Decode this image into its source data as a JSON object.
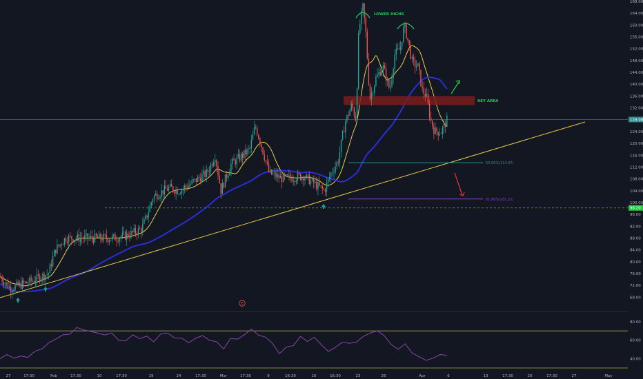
{
  "chart_data": [
    {
      "type": "candlestick",
      "panel": "price",
      "ylim": [
        66,
        168
      ],
      "y_ticks": [
        68,
        72,
        76,
        80,
        84,
        88,
        92,
        96,
        100,
        104,
        108,
        112,
        116,
        120,
        124,
        128,
        132,
        136,
        140,
        144,
        148,
        152,
        156,
        160,
        164,
        168
      ],
      "x_tick_labels": [
        "27",
        "17:30",
        "Feb",
        "17:30",
        "10",
        "17:30",
        "19",
        "24",
        "17:30",
        "Mar",
        "17:30",
        "9",
        "16:30",
        "16",
        "16:30",
        "23",
        "26",
        "Apr",
        "6",
        "13",
        "17:30",
        "20",
        "17:30",
        "27",
        "May"
      ],
      "price_key_points": [
        {
          "x": 0,
          "y": 75
        },
        {
          "x": 15,
          "y": 71
        },
        {
          "x": 40,
          "y": 73
        },
        {
          "x": 70,
          "y": 76
        },
        {
          "x": 80,
          "y": 84
        },
        {
          "x": 95,
          "y": 88
        },
        {
          "x": 120,
          "y": 88
        },
        {
          "x": 165,
          "y": 88
        },
        {
          "x": 185,
          "y": 89
        },
        {
          "x": 205,
          "y": 91
        },
        {
          "x": 212,
          "y": 95
        },
        {
          "x": 222,
          "y": 102
        },
        {
          "x": 245,
          "y": 105
        },
        {
          "x": 260,
          "y": 104
        },
        {
          "x": 280,
          "y": 107
        },
        {
          "x": 300,
          "y": 110
        },
        {
          "x": 312,
          "y": 116
        },
        {
          "x": 320,
          "y": 104
        },
        {
          "x": 335,
          "y": 113
        },
        {
          "x": 352,
          "y": 116
        },
        {
          "x": 362,
          "y": 118
        },
        {
          "x": 370,
          "y": 126
        },
        {
          "x": 378,
          "y": 120
        },
        {
          "x": 390,
          "y": 110
        },
        {
          "x": 410,
          "y": 108
        },
        {
          "x": 440,
          "y": 109
        },
        {
          "x": 458,
          "y": 106
        },
        {
          "x": 470,
          "y": 104
        },
        {
          "x": 480,
          "y": 110
        },
        {
          "x": 490,
          "y": 114
        },
        {
          "x": 500,
          "y": 127
        },
        {
          "x": 510,
          "y": 133
        },
        {
          "x": 516,
          "y": 128
        },
        {
          "x": 520,
          "y": 158
        },
        {
          "x": 526,
          "y": 166
        },
        {
          "x": 530,
          "y": 158
        },
        {
          "x": 536,
          "y": 135
        },
        {
          "x": 545,
          "y": 142
        },
        {
          "x": 555,
          "y": 146
        },
        {
          "x": 565,
          "y": 138
        },
        {
          "x": 572,
          "y": 150
        },
        {
          "x": 580,
          "y": 152
        },
        {
          "x": 586,
          "y": 160
        },
        {
          "x": 592,
          "y": 154
        },
        {
          "x": 598,
          "y": 147
        },
        {
          "x": 606,
          "y": 146
        },
        {
          "x": 612,
          "y": 138
        },
        {
          "x": 618,
          "y": 136
        },
        {
          "x": 624,
          "y": 128
        },
        {
          "x": 630,
          "y": 124
        },
        {
          "x": 640,
          "y": 124
        },
        {
          "x": 648,
          "y": 128
        }
      ],
      "current_price": 128.08,
      "current_price_label": "128.08",
      "support_price": 98.2,
      "support_label": "98.20",
      "key_area": {
        "low": 133,
        "high": 136,
        "label": "KEY AREA"
      },
      "annotation_lower_highs": "LOWER HIGHS",
      "fib_50": {
        "price": 113.47,
        "label": "50.00%(113.47)"
      },
      "fib_618": {
        "price": 101.21,
        "label": "61.80%(101.21)"
      },
      "ma_fast_color": "#e8d24a",
      "ma_slow_color": "#2a2ed8",
      "trendline_color": "#e6c84a",
      "up_color": "#26a69a",
      "down_color": "#ef5350",
      "arrow_up_color": "#27c93f",
      "arrow_down_color": "#e03b3b",
      "key_area_color": "#7a1c1c",
      "support_color": "#27c93f",
      "fib_50_color": "#2a8f8f",
      "fib_618_color": "#8b3fd6",
      "lower_highs_color": "#22c55e",
      "markers": [
        "E"
      ]
    },
    {
      "type": "line",
      "panel": "rsi",
      "series": [
        {
          "values": [
            38,
            42,
            39,
            45,
            43,
            48,
            52,
            55,
            60,
            65,
            68,
            72,
            70,
            68,
            70,
            64,
            66,
            62,
            60,
            64,
            63,
            62,
            60,
            64,
            66,
            63,
            62,
            58,
            60,
            65,
            62,
            56,
            52,
            62,
            64,
            68,
            70,
            65,
            62,
            56,
            48,
            54,
            56,
            62,
            60,
            66,
            56,
            50,
            52,
            55,
            58,
            60,
            66,
            70,
            72,
            66,
            58,
            52,
            54,
            46,
            42,
            40,
            38,
            44,
            42
          ]
        }
      ],
      "ylim": [
        30,
        88
      ],
      "y_ticks": [
        40,
        60,
        80
      ],
      "upper_band": 70,
      "lower_band": 30,
      "line_color": "#8e44ad",
      "band_color": "#b8a842"
    }
  ]
}
